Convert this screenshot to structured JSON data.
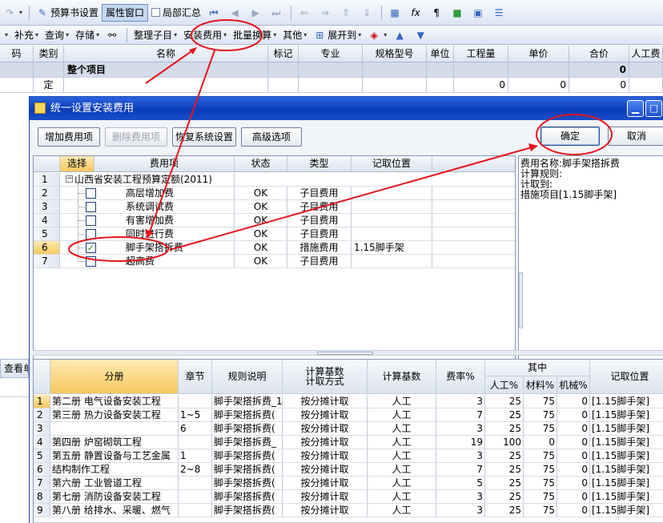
{
  "toolbar1": {
    "budget_settings": "预算书设置",
    "property_window": "属性窗口",
    "local_summary": "局部汇总"
  },
  "toolbar2": {
    "supplement": "补充",
    "query": "查询",
    "save": "存储",
    "organize": "整理子目",
    "install_fee": "安装费用",
    "batch_convert": "批量换算",
    "other": "其他",
    "expand_to": "展开到"
  },
  "main_grid": {
    "columns": [
      "码",
      "类别",
      "名称",
      "标记",
      "专业",
      "规格型号",
      "单位",
      "工程量",
      "单价",
      "合价",
      "人工费"
    ],
    "row1": {
      "name": "整个项目",
      "total": "0"
    },
    "row2": {
      "type": "定",
      "qty": "0",
      "price": "0",
      "total": "0"
    },
    "bottom_tab": "查看单"
  },
  "dialog": {
    "title": "统一设置安装费用",
    "buttons": {
      "add_fee": "增加费用项",
      "delete_fee": "删除费用项",
      "restore": "恢复系统设置",
      "advanced": "高级选项",
      "ok": "确定",
      "cancel": "取消"
    },
    "tree_columns": [
      "选择",
      "费用项",
      "状态",
      "类型",
      "记取位置"
    ],
    "tree_rows": [
      {
        "no": "1",
        "name": "山西省安装工程预算定额(2011)",
        "status": "",
        "type": "",
        "pos": ""
      },
      {
        "no": "2",
        "name": "高层增加费",
        "status": "OK",
        "type": "子目费用",
        "pos": ""
      },
      {
        "no": "3",
        "name": "系统调试费",
        "status": "OK",
        "type": "子目费用",
        "pos": ""
      },
      {
        "no": "4",
        "name": "有害增加费",
        "status": "OK",
        "type": "子目费用",
        "pos": ""
      },
      {
        "no": "5",
        "name": "同时进行费",
        "status": "OK",
        "type": "子目费用",
        "pos": ""
      },
      {
        "no": "6",
        "name": "脚手架搭拆费",
        "status": "OK",
        "type": "措施费用",
        "pos": "1.15脚手架",
        "checked": "✓"
      },
      {
        "no": "7",
        "name": "超高费",
        "status": "OK",
        "type": "子目费用",
        "pos": ""
      }
    ],
    "info": {
      "line1": "费用名称:脚手架搭拆费",
      "line2": "计算规则:",
      "line3": "计取到:",
      "line4": "措施项目[1.15脚手架]"
    },
    "lower_columns": {
      "book": "分册",
      "chapter": "章节",
      "rule": "规则说明",
      "base_method": "计算基数计取方式",
      "base": "计算基数",
      "rate": "费率%",
      "among": "其中",
      "labor": "人工%",
      "material": "材料%",
      "machine": "机械%",
      "pos": "记取位置"
    },
    "lower_rows": [
      {
        "no": "1",
        "book": "第二册 电气设备安装工程",
        "chapter": "",
        "rule": "脚手架搭拆费_1",
        "method": "按分摊计取",
        "base": "人工",
        "rate": "3",
        "labor": "25",
        "material": "75",
        "machine": "0",
        "pos": "[1.15脚手架]"
      },
      {
        "no": "2",
        "book": "第三册 热力设备安装工程",
        "chapter": "1~5",
        "rule": "脚手架搭拆费(",
        "method": "按分摊计取",
        "base": "人工",
        "rate": "7",
        "labor": "25",
        "material": "75",
        "machine": "0",
        "pos": "[1.15脚手架]"
      },
      {
        "no": "3",
        "book": "",
        "chapter": "6",
        "rule": "脚手架搭拆费(",
        "method": "按分摊计取",
        "base": "人工",
        "rate": "3",
        "labor": "25",
        "material": "75",
        "machine": "0",
        "pos": "[1.15脚手架]"
      },
      {
        "no": "4",
        "book": "第四册 炉窑砌筑工程",
        "chapter": "",
        "rule": "脚手架搭拆费_",
        "method": "按分摊计取",
        "base": "人工",
        "rate": "19",
        "labor": "100",
        "material": "0",
        "machine": "0",
        "pos": "[1.15脚手架]"
      },
      {
        "no": "5",
        "book": "第五册 静置设备与工艺金属",
        "chapter": "1",
        "rule": "脚手架搭拆费(",
        "method": "按分摊计取",
        "base": "人工",
        "rate": "3",
        "labor": "25",
        "material": "75",
        "machine": "0",
        "pos": "[1.15脚手架]"
      },
      {
        "no": "6",
        "book": "结构制作工程",
        "chapter": "2~8",
        "rule": "脚手架搭拆费(",
        "method": "按分摊计取",
        "base": "人工",
        "rate": "7",
        "labor": "25",
        "material": "75",
        "machine": "0",
        "pos": "[1.15脚手架]"
      },
      {
        "no": "7",
        "book": "第六册 工业管道工程",
        "chapter": "",
        "rule": "脚手架搭拆费(",
        "method": "按分摊计取",
        "base": "人工",
        "rate": "5",
        "labor": "25",
        "material": "75",
        "machine": "0",
        "pos": "[1.15脚手架]"
      },
      {
        "no": "8",
        "book": "第七册 消防设备安装工程",
        "chapter": "",
        "rule": "脚手架搭拆费(",
        "method": "按分摊计取",
        "base": "人工",
        "rate": "3",
        "labor": "25",
        "material": "75",
        "machine": "0",
        "pos": "[1.15脚手架]"
      },
      {
        "no": "9",
        "book": "第八册 给排水、采暖、燃气",
        "chapter": "",
        "rule": "脚手架搭拆费(",
        "method": "按分摊计取",
        "base": "人工",
        "rate": "3",
        "labor": "25",
        "material": "75",
        "machine": "0",
        "pos": "[1.15脚手架]"
      }
    ]
  },
  "colors": {
    "annotation": "#e8141c",
    "title_bar": "#0a3bb8",
    "selected_header": "#f7c85e"
  }
}
